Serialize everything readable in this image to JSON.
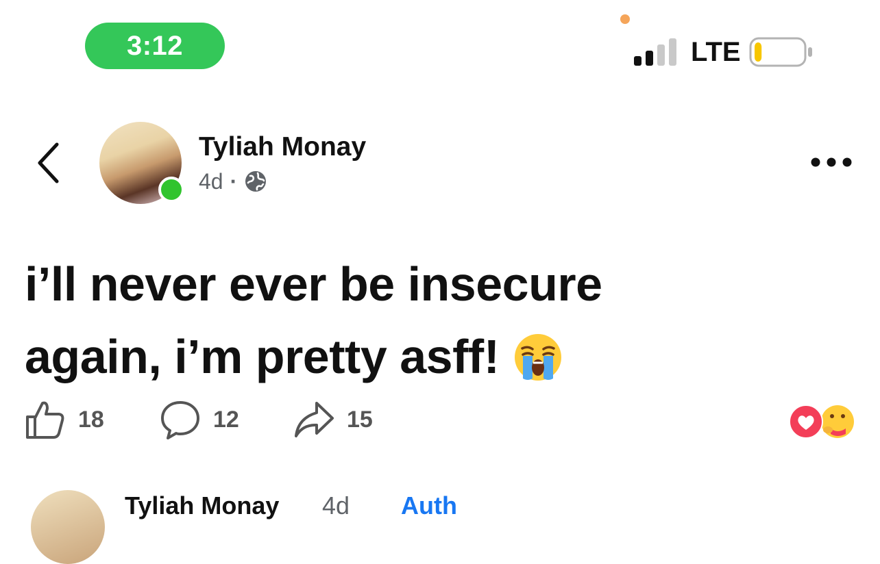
{
  "status_bar": {
    "time": "3:12",
    "network": "LTE",
    "battery_level": 0.15,
    "battery_color": "#f7c600",
    "signal_bars": 2
  },
  "post": {
    "author": "Tyliah Monay",
    "age": "4d",
    "separator": "·",
    "audience_icon": "globe-icon",
    "text_line1": "i’ll never ever be insecure",
    "text_line2": "again, i’m pretty asff!",
    "emoji": "loudly-crying-face",
    "likes": "18",
    "comments": "12",
    "shares": "15",
    "reactions": [
      "love-icon",
      "care-icon"
    ],
    "online_color": "#31c42e"
  },
  "next_post": {
    "author": "Tyliah Monay",
    "age": "4d",
    "link": "Auth"
  },
  "colors": {
    "time_pill": "#34c759",
    "love": "#f33e58",
    "link": "#1877f2"
  }
}
